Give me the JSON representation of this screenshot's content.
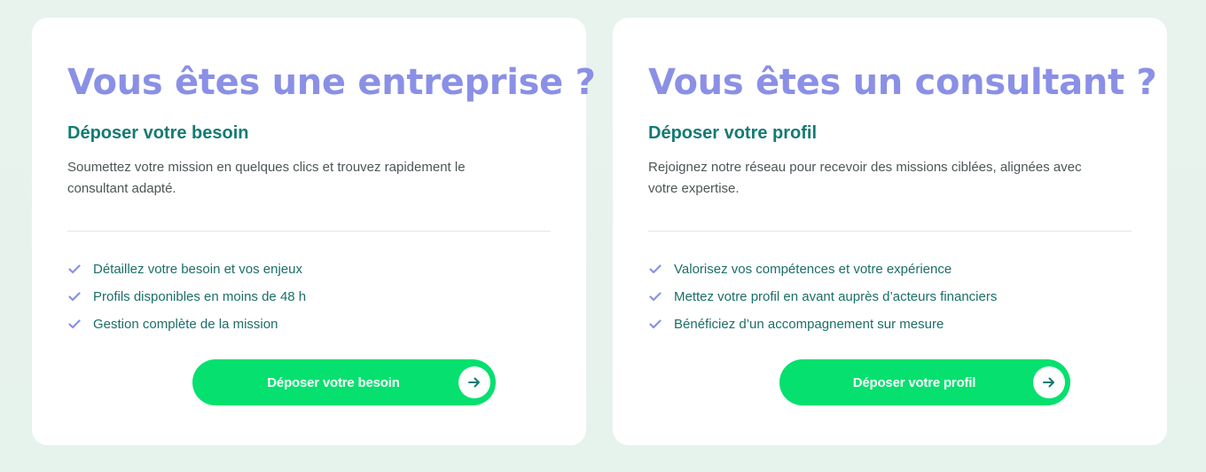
{
  "colors": {
    "title": "#8a90e6",
    "subtitle": "#147a73",
    "check": "#8a90e6",
    "cta": "#05e06e",
    "arrow": "#147a73"
  },
  "company": {
    "title": "Vous êtes une entreprise ?",
    "subtitle": "Déposer votre besoin",
    "description": "Soumettez votre mission en quelques clics et trouvez rapidement le consultant adapté.",
    "features": [
      "Détaillez votre besoin et vos enjeux",
      "Profils disponibles en moins de 48 h",
      "Gestion complète de la mission"
    ],
    "cta_label": "Déposer votre besoin",
    "cta_icon": "arrow-right-icon"
  },
  "consultant": {
    "title": "Vous êtes un consultant ?",
    "subtitle": "Déposer votre profil",
    "description": "Rejoignez notre réseau pour recevoir des missions ciblées, alignées avec votre expertise.",
    "features": [
      "Valorisez vos compétences et votre expérience",
      "Mettez votre profil en avant auprès d’acteurs financiers",
      "Bénéficiez d’un accompagnement sur mesure"
    ],
    "cta_label": "Déposer votre profil",
    "cta_icon": "arrow-right-icon"
  }
}
